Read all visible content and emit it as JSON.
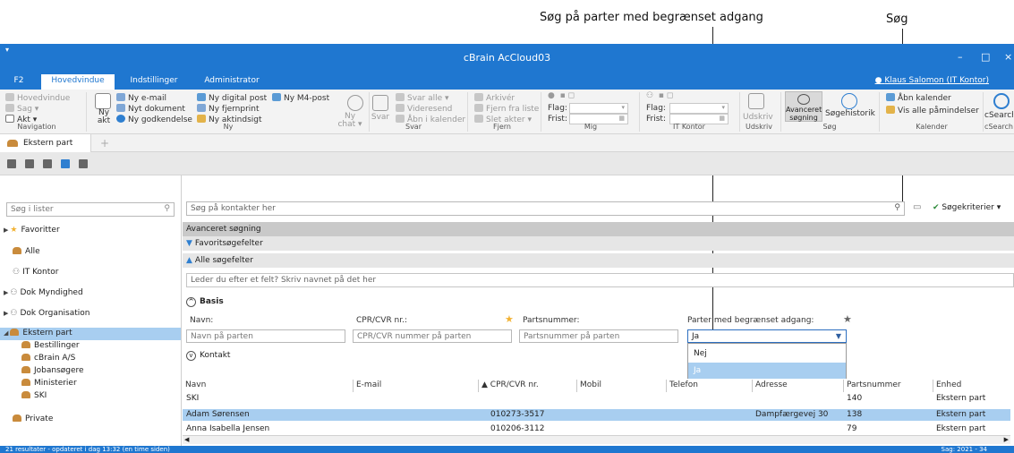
{
  "callouts": {
    "restricted_search": "Søg på parter med begrænset adgang",
    "search": "Søg"
  },
  "window": {
    "title": "cBrain AcCloud03",
    "minimize_glyph": "–",
    "maximize_glyph": "□",
    "close_glyph": "×"
  },
  "tabs": [
    {
      "label": "F2"
    },
    {
      "label": "Hovedvindue"
    },
    {
      "label": "Indstillinger"
    },
    {
      "label": "Administrator"
    }
  ],
  "user": {
    "label": "Klaus Salomon (IT Kontor)"
  },
  "ribbon": {
    "navigation": {
      "hovedvindue": "Hovedvindue",
      "sag": "Sag ▾",
      "akt": "Akt ▾",
      "group": "Navigation"
    },
    "ny": {
      "ny_akt": "Ny akt",
      "ny_email": "Ny e-mail",
      "nyt_dokument": "Nyt dokument",
      "ny_godkendelse": "Ny godkendelse",
      "ny_digital_post": "Ny digital post",
      "ny_m4_post": "Ny M4-post",
      "ny_fjernprint": "Ny fjernprint",
      "ny_aktindsigt": "Ny aktindsigt",
      "ny_chat": "Ny chat ▾",
      "group": "Ny"
    },
    "svar": {
      "svar": "Svar",
      "svar_alle": "Svar alle ▾",
      "videresend": "Videresend",
      "aabn_i_kalender": "Åbn i kalender",
      "group": "Svar"
    },
    "fjern": {
      "arkiver": "Arkivér",
      "fjern_fra_liste": "Fjern fra liste",
      "slet_akter": "Slet akter ▾",
      "group": "Fjern"
    },
    "mig": {
      "flag": "Flag:",
      "frist": "Frist:",
      "group": "Mig"
    },
    "it_kontor": {
      "flag": "Flag:",
      "frist": "Frist:",
      "group": "IT Kontor"
    },
    "udskriv": {
      "label": "Udskriv",
      "group": "Udskriv"
    },
    "soeg": {
      "avanceret_soegning": "Avanceret søgning",
      "soegehistorik": "Søgehistorik",
      "group": "Søg"
    },
    "kalender": {
      "aabn_kalender": "Åbn kalender",
      "vis_alle_paamindelser": "Vis alle påmindelser",
      "group": "Kalender"
    },
    "csearch": {
      "label": "cSearch",
      "group": "cSearch"
    }
  },
  "doc_tab": {
    "label": "Ekstern part",
    "add_glyph": "+"
  },
  "left_pane": {
    "search_placeholder": "Søg i lister",
    "items": [
      {
        "label": "Favoritter"
      },
      {
        "label": "Alle"
      },
      {
        "label": "IT Kontor"
      },
      {
        "label": "Dok Myndighed"
      },
      {
        "label": "Dok Organisation"
      },
      {
        "label": "Ekstern part"
      },
      {
        "label": "Bestillinger"
      },
      {
        "label": "cBrain A/S"
      },
      {
        "label": "Jobansøgere"
      },
      {
        "label": "Ministerier"
      },
      {
        "label": "SKI"
      },
      {
        "label": "Private"
      }
    ]
  },
  "main": {
    "search_placeholder": "Søg på kontakter her",
    "search_criteria": "Søgekriterier",
    "advanced_search": "Avanceret søgning",
    "favorite_fields": "Favoritsøgefelter",
    "all_fields": "Alle søgefelter",
    "field_hint": "Leder du efter et felt? Skriv navnet på det her",
    "basis": "Basis",
    "kontakt": "Kontakt",
    "fields": {
      "navn": {
        "label": "Navn:",
        "placeholder": "Navn på parten"
      },
      "cpr": {
        "label": "CPR/CVR nr.:",
        "placeholder": "CPR/CVR nummer på parten"
      },
      "partsnummer": {
        "label": "Partsnummer:",
        "placeholder": "Partsnummer på parten"
      },
      "restricted": {
        "label": "Parter med begrænset adgang:",
        "value": "Ja",
        "options": [
          "Nej",
          "Ja"
        ]
      }
    }
  },
  "table": {
    "columns": [
      "Navn",
      "E-mail",
      "CPR/CVR nr.",
      "Mobil",
      "Telefon",
      "Adresse",
      "Partsnummer",
      "Enhed"
    ],
    "rows": [
      {
        "navn": "SKI",
        "email": "",
        "cpr": "",
        "mobil": "",
        "telefon": "",
        "adresse": "",
        "partsnummer": "140",
        "enhed": "Ekstern part"
      },
      {
        "navn": "Adam Sørensen",
        "email": "",
        "cpr": "010273-3517",
        "mobil": "",
        "telefon": "",
        "adresse": "Dampfærgevej 30",
        "partsnummer": "138",
        "enhed": "Ekstern part"
      },
      {
        "navn": "Anna Isabella Jensen",
        "email": "",
        "cpr": "010206-3112",
        "mobil": "",
        "telefon": "",
        "adresse": "",
        "partsnummer": "79",
        "enhed": "Ekstern part"
      }
    ]
  },
  "status": {
    "left": "21 resultater - opdateret i dag 13:32 (en time siden)",
    "right": "Sag: 2021 - 34"
  }
}
